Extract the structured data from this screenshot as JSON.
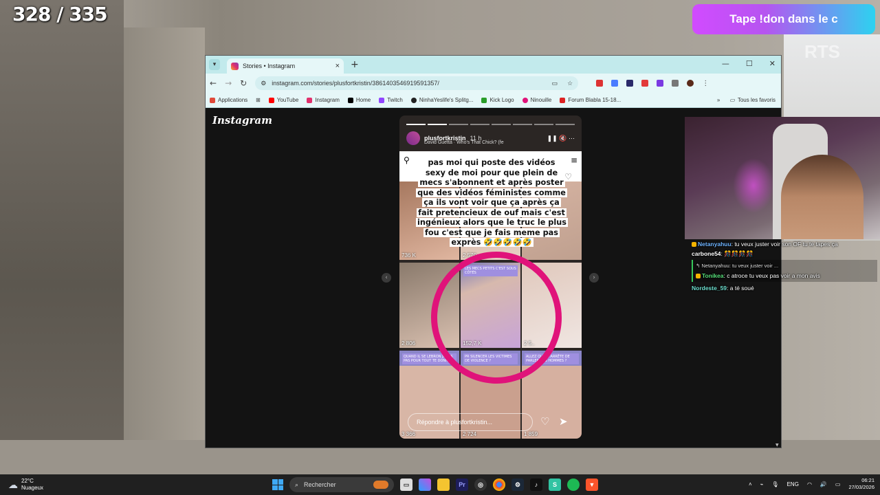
{
  "overlay": {
    "counter": "328 / 335",
    "donation_banner": "Tape !don dans le c",
    "watermark": "RTS"
  },
  "browser": {
    "tab_title": "Stories • Instagram",
    "url": "instagram.com/stories/plusfortkristin/3861403546919591357/",
    "bookmarks": [
      "Applications",
      "YouTube",
      "Instagram",
      "Home",
      "Twitch",
      "NinhaYeslife's Splitg...",
      "Kick Logo",
      "Ninouille",
      "Forum Blabla 15-18..."
    ],
    "bookmarks_folder": "Tous les favoris"
  },
  "instagram": {
    "logo": "Instagram",
    "story": {
      "username": "plusfortkristin",
      "time": "11 h",
      "music": "David Guetta · Who's That Chick? (fe",
      "text_overlay": "pas moi qui poste des vidéos sexy de moi pour que plein de mecs s'abonnent et après poster que des vidéos féministes comme ça ils vont voir que ça après ça fait pretencieux de ouf mais c'est ingénieux alors que le truc le plus fou c'est que je fais meme pas exprès 🤣🤣🤣🤣🤣",
      "grid_counts": [
        "736 K",
        "2 570",
        "2 806",
        "152,7 K",
        "2 5..",
        "3 366",
        "2 724",
        "1 859"
      ],
      "grid_captions": [
        "LES MECS PETITS C'EST SOUS CÔTÉS",
        "QUAND IL SE LEBRON JAMES PAS POUR TOUT TE DONNER",
        "PR SILENCER LES VICTIMES DE VIOLENCE ?",
        "ALLEZ QU'ON ARRÊTE DE PARLER DES HOMMES ?"
      ],
      "reply_placeholder": "Répondre à plusfortkristin..."
    },
    "annotation_color": "#e0137a"
  },
  "chat": [
    {
      "user": "Netanyahuu",
      "text": "tu veux juster voir son OF tu te tapes ça",
      "color": "#6fb4ff"
    },
    {
      "user": "carbone54",
      "text": "🎊🎊🎊🎊",
      "color": "#ffffff"
    },
    {
      "reply_to": "Netanyahuu: tu veux juster voir ...",
      "user": "Tonikea",
      "text": "c atroce tu veux pas voir a mon avis",
      "color": "#57e07a"
    },
    {
      "user": "Nordeste_59",
      "text": "a té soué",
      "color": "#6fe0d0"
    }
  ],
  "taskbar": {
    "weather_temp": "22°C",
    "weather_desc": "Nuageux",
    "search_placeholder": "Rechercher",
    "lang": "ENG",
    "time": "06:21",
    "date": "27/03/2026"
  }
}
